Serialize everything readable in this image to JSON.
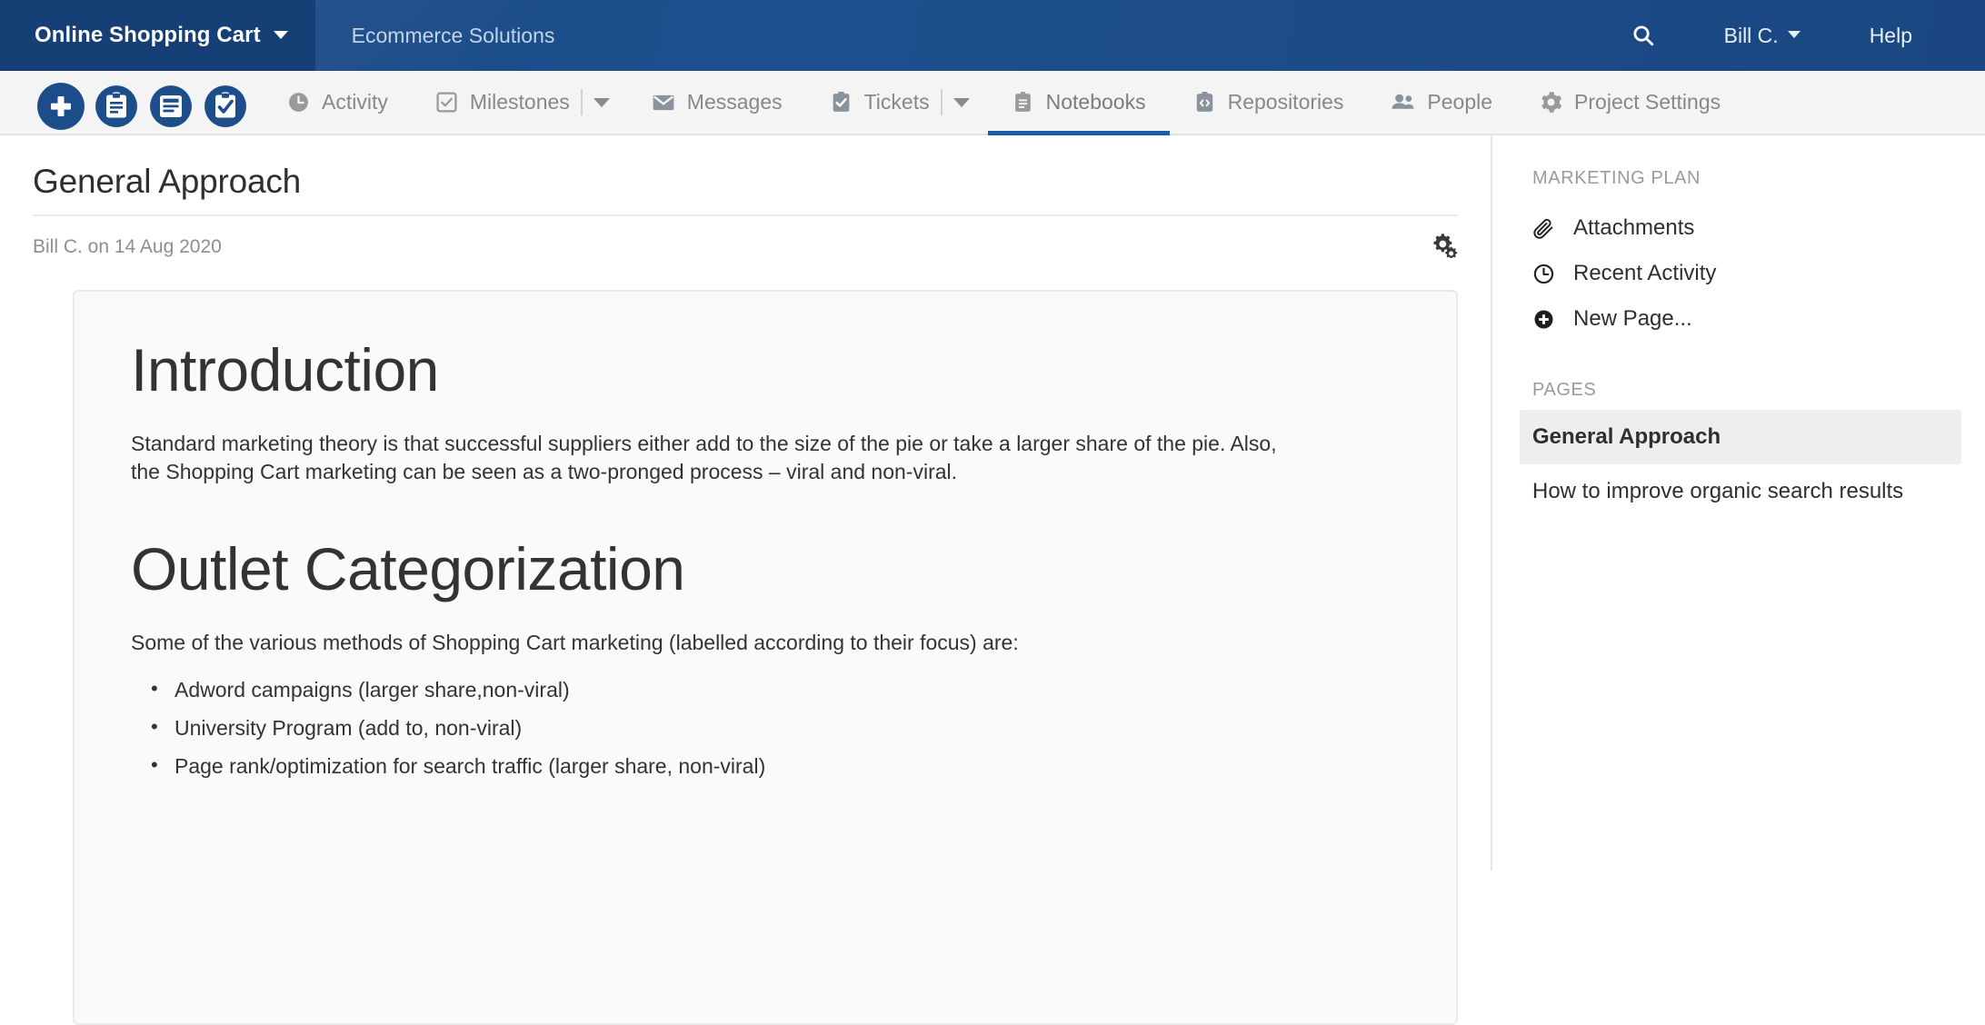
{
  "topbar": {
    "project_name": "Online Shopping Cart",
    "subtitle": "Ecommerce Solutions",
    "search_icon": "search-icon",
    "user_name": "Bill C.",
    "help_label": "Help"
  },
  "nav": {
    "quick_actions": [
      {
        "icon": "plus-icon",
        "name": "new-item"
      },
      {
        "icon": "clipboard-text-icon",
        "name": "new-note"
      },
      {
        "icon": "document-lines-icon",
        "name": "new-document"
      },
      {
        "icon": "clipboard-check-icon",
        "name": "new-task"
      }
    ],
    "items": [
      {
        "label": "Activity",
        "icon": "clock-icon",
        "active": false,
        "caret": false
      },
      {
        "label": "Milestones",
        "icon": "checkbox-icon",
        "active": false,
        "caret": true
      },
      {
        "label": "Messages",
        "icon": "envelope-icon",
        "active": false,
        "caret": false
      },
      {
        "label": "Tickets",
        "icon": "clipboard-check-icon",
        "active": false,
        "caret": true
      },
      {
        "label": "Notebooks",
        "icon": "notebook-icon",
        "active": true,
        "caret": false
      },
      {
        "label": "Repositories",
        "icon": "code-clipboard-icon",
        "active": false,
        "caret": false
      },
      {
        "label": "People",
        "icon": "people-icon",
        "active": false,
        "caret": false
      },
      {
        "label": "Project Settings",
        "icon": "gear-icon",
        "active": false,
        "caret": false
      }
    ],
    "active_underline_color": "#1a5bab"
  },
  "page": {
    "title": "General Approach",
    "byline": "Bill C. on 14 Aug 2020",
    "settings_icon": "cogs-icon"
  },
  "document": {
    "heading_1": "Introduction",
    "paragraph_1": "Standard marketing theory is that successful suppliers either add to the size of the pie or take a larger share of the pie. Also, the Shopping Cart marketing can be seen as a two-pronged process – viral and non-viral.",
    "heading_2": "Outlet Categorization",
    "paragraph_2": "Some of the various methods of Shopping Cart marketing (labelled according to their focus) are:",
    "list": [
      "Adword campaigns (larger share,non-viral)",
      "University Program (add to, non-viral)",
      "Page rank/optimization for search traffic (larger share, non-viral)"
    ]
  },
  "sidebar": {
    "section_title": "MARKETING PLAN",
    "links": [
      {
        "label": "Attachments",
        "icon": "paperclip-icon"
      },
      {
        "label": "Recent Activity",
        "icon": "clock-icon"
      },
      {
        "label": "New Page...",
        "icon": "plus-circle-icon"
      }
    ],
    "pages_title": "PAGES",
    "pages": [
      {
        "label": "General Approach",
        "selected": true
      },
      {
        "label": "How to improve organic search results",
        "selected": false
      }
    ]
  },
  "colors": {
    "header_blue": "#1b4a86",
    "header_tab_blue": "#153f75",
    "accent_blue": "#1a5bab",
    "nav_bg": "#f4f4f4",
    "selected_page_bg": "#eeeeee"
  }
}
